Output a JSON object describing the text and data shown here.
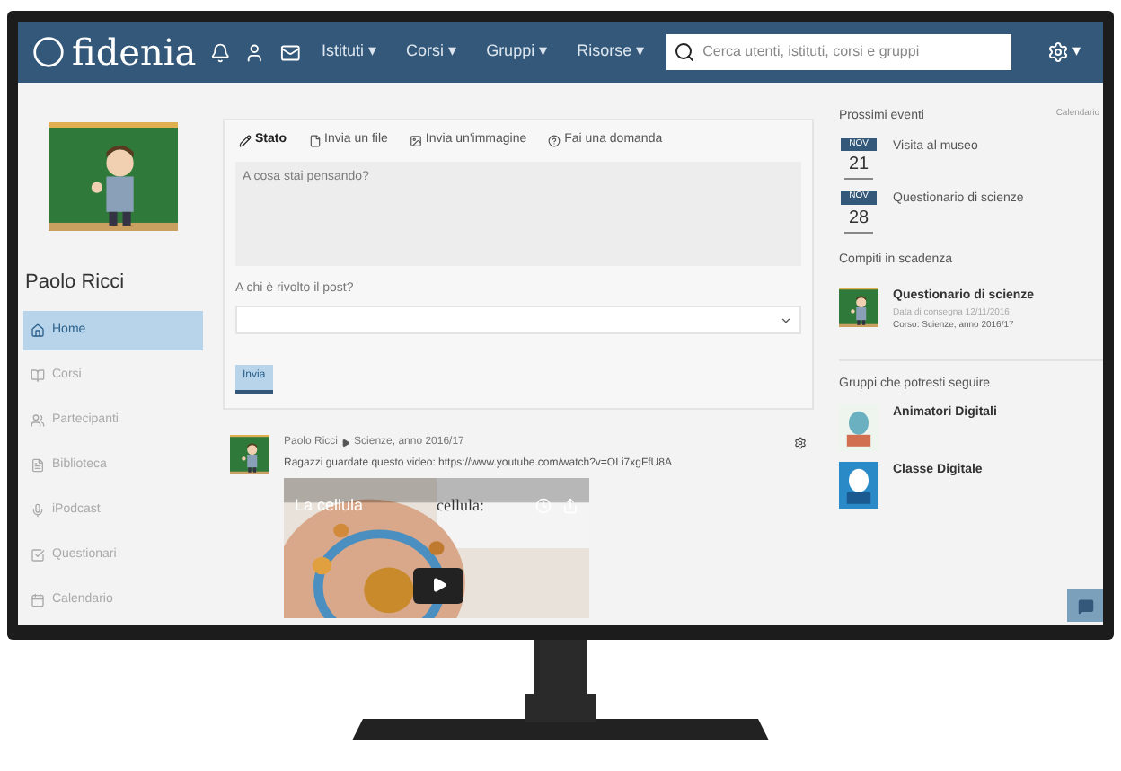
{
  "navbar": {
    "logo": "fidenia",
    "menus": [
      "Istituti ▾",
      "Corsi ▾",
      "Gruppi ▾",
      "Risorse ▾"
    ],
    "search": {
      "placeholder": "Cerca utenti, istituti, corsi e gruppi"
    },
    "settings": "▾"
  },
  "profile": {
    "name": "Paolo Ricci"
  },
  "sidebar": {
    "items": [
      {
        "label": "Home",
        "selected": true
      },
      {
        "label": "Corsi",
        "selected": false
      },
      {
        "label": "Partecipanti",
        "selected": false
      },
      {
        "label": "Biblioteca",
        "selected": false
      },
      {
        "label": "iPodcast",
        "selected": false
      },
      {
        "label": "Questionari",
        "selected": false
      },
      {
        "label": "Calendario",
        "selected": false
      }
    ]
  },
  "composer": {
    "tabs": [
      {
        "label": "Stato",
        "selected": true
      },
      {
        "label": "Invia un file",
        "selected": false
      },
      {
        "label": "Invia un'immagine",
        "selected": false
      },
      {
        "label": "Fai una domanda",
        "selected": false
      }
    ],
    "placeholder": "A cosa stai pensando?",
    "audience_label": "A chi è rivolto il post?",
    "send": "Invia"
  },
  "post": {
    "author": "Paolo Ricci",
    "target": "Scienze, anno 2016/17",
    "text": "Ragazzi guardate questo video: https://www.youtube.com/watch?v=OLi7xgFfU8A",
    "video": {
      "title": "La cellula",
      "caption": "cellula:"
    }
  },
  "events": {
    "title": "Prossimi eventi",
    "link": "Calendario",
    "items": [
      {
        "month": "NOV",
        "day": "21",
        "title": "Visita al museo"
      },
      {
        "month": "NOV",
        "day": "28",
        "title": "Questionario di scienze"
      }
    ]
  },
  "assignments": {
    "title": "Compiti in scadenza",
    "items": [
      {
        "title": "Questionario di scienze",
        "due": "Data di consegna 12/11/2016",
        "course_label": "Corso:",
        "course": "Scienze, anno 2016/17"
      }
    ]
  },
  "groups": {
    "title": "Gruppi che potresti seguire",
    "items": [
      {
        "name": "Animatori Digitali"
      },
      {
        "name": "Classe Digitale"
      }
    ]
  }
}
